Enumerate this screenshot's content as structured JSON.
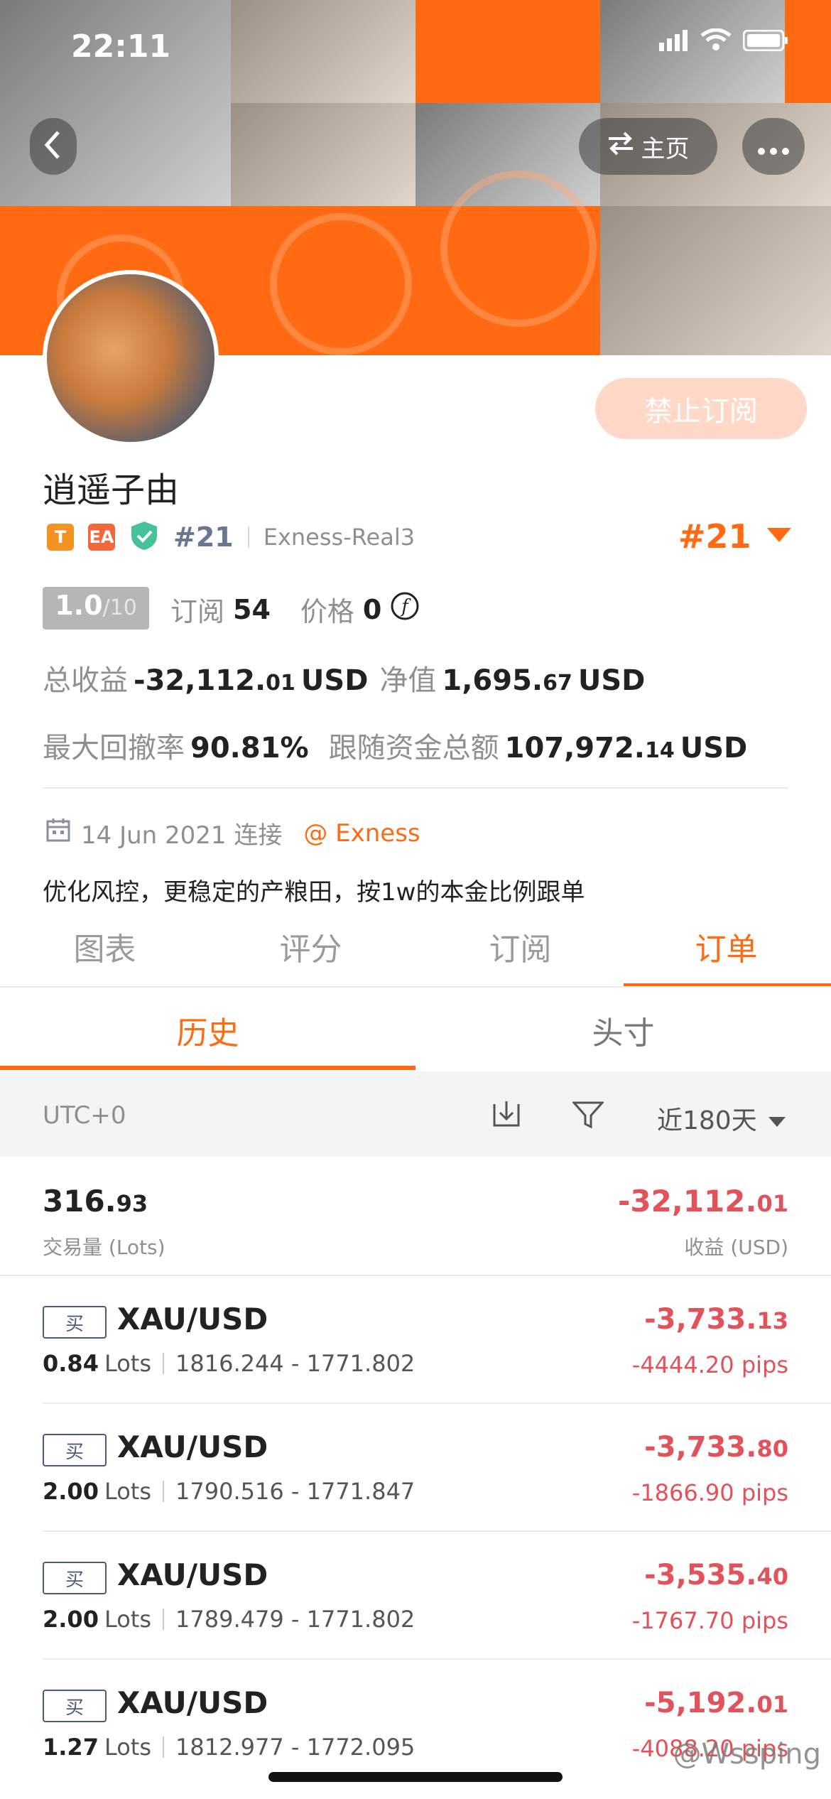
{
  "status_bar": {
    "time": "22:11"
  },
  "header": {
    "home_label": "主页"
  },
  "profile": {
    "name": "逍遥子由",
    "badges": [
      "T",
      "EA"
    ],
    "rank": "#21",
    "server": "Exness-Real3",
    "rank_right": "#21",
    "subscribe_button": "禁止订阅",
    "rating_value": "1.0",
    "rating_max": "/10",
    "subscriptions_label": "订阅",
    "subscriptions_value": "54",
    "price_label": "价格",
    "price_value": "0",
    "total_profit_label": "总收益",
    "total_profit_int": "-32,112.",
    "total_profit_dec": "01",
    "total_profit_unit": "USD",
    "equity_label": "净值",
    "equity_int": "1,695.",
    "equity_dec": "67",
    "equity_unit": "USD",
    "max_drawdown_label": "最大回撤率",
    "max_drawdown_value": "90.81%",
    "follow_funds_label": "跟随资金总额",
    "follow_funds_int": "107,972.",
    "follow_funds_dec": "14",
    "follow_funds_unit": "USD",
    "connected_date": "14 Jun 2021 连接",
    "broker_link": "@ Exness",
    "description": "优化风控，更稳定的产粮田，按1w的本金比例跟单"
  },
  "tabs": [
    "图表",
    "评分",
    "订阅",
    "订单"
  ],
  "subtabs": [
    "历史",
    "头寸"
  ],
  "filter_bar": {
    "timezone": "UTC+0",
    "range": "近180天"
  },
  "summary": {
    "volume_int": "316.",
    "volume_dec": "93",
    "volume_label": "交易量 (Lots)",
    "profit_int": "-32,112.",
    "profit_dec": "01",
    "profit_label": "收益 (USD)"
  },
  "orders": [
    {
      "side": "买",
      "symbol": "XAU/USD",
      "lots": "0.84",
      "lots_unit": "Lots",
      "prices": "1816.244 - 1771.802",
      "profit_int": "-3,733.",
      "profit_dec": "13",
      "pips": "-4444.20 pips"
    },
    {
      "side": "买",
      "symbol": "XAU/USD",
      "lots": "2.00",
      "lots_unit": "Lots",
      "prices": "1790.516 - 1771.847",
      "profit_int": "-3,733.",
      "profit_dec": "80",
      "pips": "-1866.90 pips"
    },
    {
      "side": "买",
      "symbol": "XAU/USD",
      "lots": "2.00",
      "lots_unit": "Lots",
      "prices": "1789.479 - 1771.802",
      "profit_int": "-3,535.",
      "profit_dec": "40",
      "pips": "-1767.70 pips"
    },
    {
      "side": "买",
      "symbol": "XAU/USD",
      "lots": "1.27",
      "lots_unit": "Lots",
      "prices": "1812.977 - 1772.095",
      "profit_int": "-5,192.",
      "profit_dec": "01",
      "pips": "-4088.20 pips"
    }
  ],
  "watermark": "@Wssping",
  "colors": {
    "accent": "#ff6a13",
    "negative": "#e2525b",
    "buy_tag": "#4c5a7a"
  }
}
